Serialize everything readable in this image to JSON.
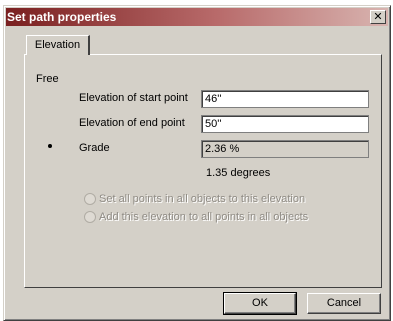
{
  "window": {
    "title": "Set path properties",
    "close_glyph": "✕"
  },
  "tabs": [
    {
      "label": "Elevation",
      "selected": true
    }
  ],
  "elevation": {
    "group_label": "Free",
    "options": [
      {
        "label": "Elevation of start point",
        "value": "46''",
        "selected": false
      },
      {
        "label": "Elevation of end point",
        "value": "50''",
        "selected": false
      },
      {
        "label": "Grade",
        "value": "2.36 %",
        "selected": true
      }
    ],
    "degrees_text": "1.35 degrees",
    "apply_options": [
      {
        "label": "Set all points in all objects to this elevation",
        "enabled": false
      },
      {
        "label": "Add this elevation to all points in all objects",
        "enabled": false
      }
    ]
  },
  "buttons": {
    "ok": "OK",
    "cancel": "Cancel"
  }
}
